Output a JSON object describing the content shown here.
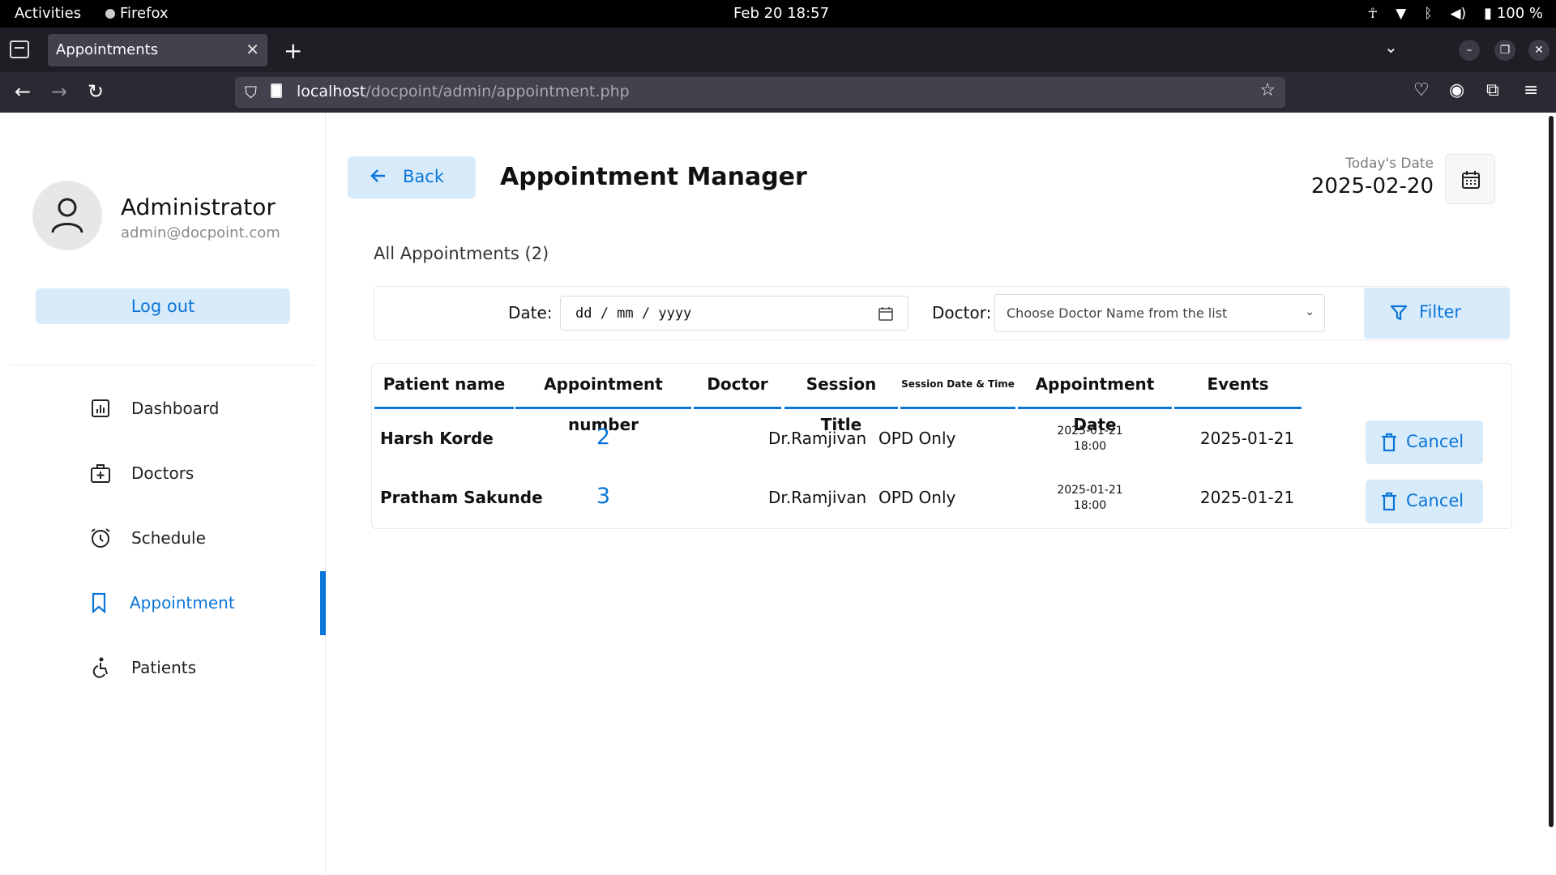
{
  "system": {
    "activities": "Activities",
    "app_name": "Firefox",
    "clock": "Feb 20  18:57",
    "battery": "100 %"
  },
  "browser": {
    "tab_title": "Appointments",
    "url_host": "localhost",
    "url_path": "/docpoint/admin/appointment.php"
  },
  "sidebar": {
    "admin_name": "Administrator",
    "admin_email": "admin@docpoint.com",
    "logout_label": "Log out",
    "items": [
      {
        "label": "Dashboard",
        "icon": "dashboard-icon"
      },
      {
        "label": "Doctors",
        "icon": "doctors-icon"
      },
      {
        "label": "Schedule",
        "icon": "schedule-icon"
      },
      {
        "label": "Appointment",
        "icon": "bookmark-icon"
      },
      {
        "label": "Patients",
        "icon": "patients-icon"
      }
    ],
    "active_item": "Appointment"
  },
  "header": {
    "back_label": "Back",
    "title": "Appointment Manager",
    "today_label": "Today's Date",
    "today_value": "2025-02-20"
  },
  "list": {
    "heading": "All Appointments (2)"
  },
  "filter": {
    "date_label": "Date:",
    "date_placeholder": "dd / mm / yyyy",
    "doctor_label": "Doctor:",
    "doctor_placeholder": "Choose Doctor Name from the list",
    "button_label": "Filter"
  },
  "table": {
    "headers": [
      "Patient name",
      "Appointment number",
      "Doctor",
      "Session Title",
      "Session Date & Time",
      "Appointment Date",
      "Events"
    ],
    "rows": [
      {
        "patient": "Harsh Korde",
        "number": "2",
        "doctor": "Dr.Ramjivan",
        "session": "OPD Only",
        "session_date": "2025-01-21",
        "session_time": "18:00",
        "appt_date": "2025-01-21",
        "action": "Cancel"
      },
      {
        "patient": "Pratham Sakunde",
        "number": "3",
        "doctor": "Dr.Ramjivan",
        "session": "OPD Only",
        "session_date": "2025-01-21",
        "session_time": "18:00",
        "appt_date": "2025-01-21",
        "action": "Cancel"
      }
    ]
  },
  "colors": {
    "accent": "#0a76d8",
    "accent_bg": "#d8ebfa"
  }
}
